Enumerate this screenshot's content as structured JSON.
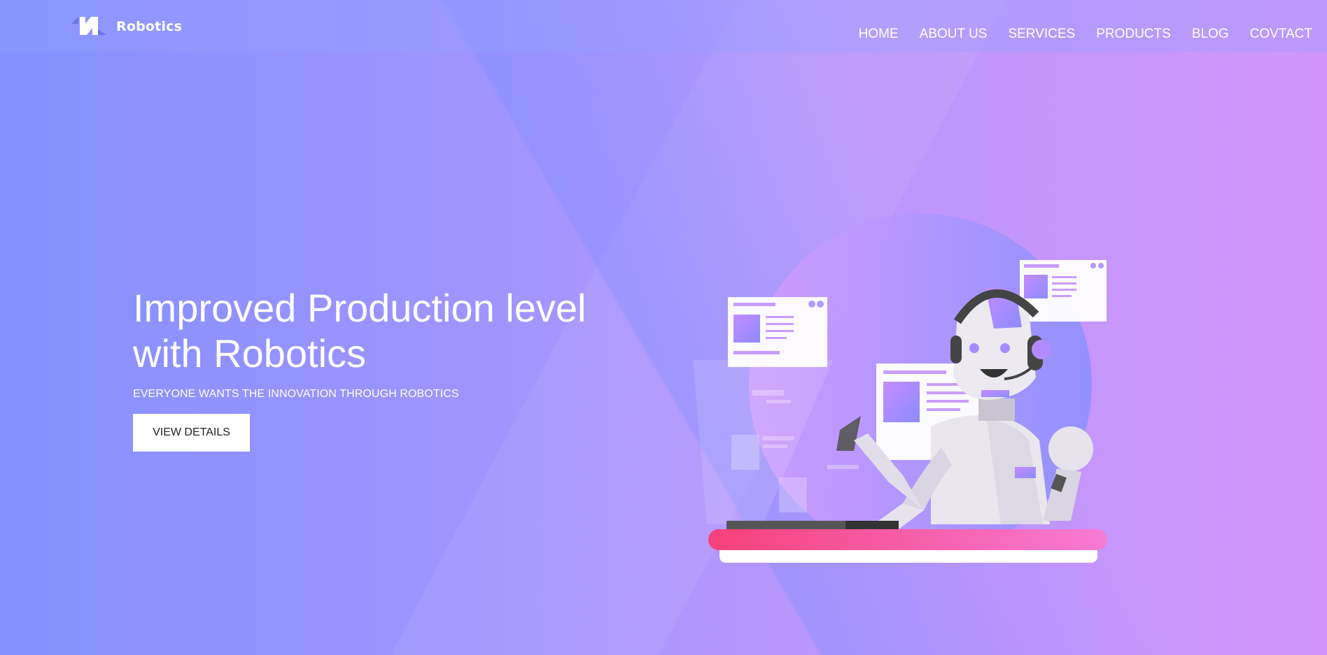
{
  "header": {
    "brand": "Robotics",
    "nav": [
      {
        "label": "HOME"
      },
      {
        "label": "ABOUT US"
      },
      {
        "label": "SERVICES"
      },
      {
        "label": "PRODUCTS"
      },
      {
        "label": "BLOG"
      },
      {
        "label": "COVTACT"
      }
    ]
  },
  "hero": {
    "title_line1": "Improved Production level",
    "title_line2": "with Robotics",
    "subtitle": "EVERYONE WANTS THE INNOVATION THROUGH ROBOTICS",
    "button_label": "VIEW DETAILS"
  },
  "colors": {
    "bg_left": "#8391ff",
    "bg_right": "#d295fb",
    "desk_pink": "#f6417a",
    "desk_light": "#f77bd6",
    "button_bg": "#ffffff"
  },
  "icons": {
    "logo": "robotics-logo-icon",
    "illustration": "robot-support-illustration"
  }
}
